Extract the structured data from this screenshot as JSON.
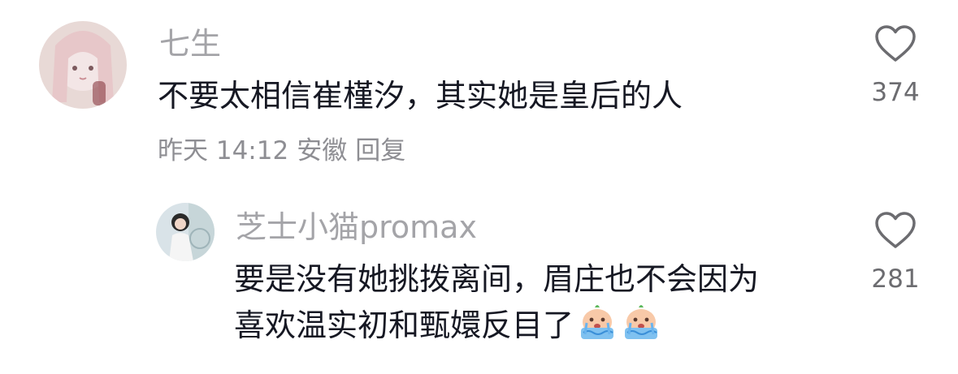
{
  "comments": [
    {
      "username": "七生",
      "text": "不要太相信崔槿汐，其实她是皇后的人",
      "time": "昨天 14:12",
      "location": "安徽",
      "reply_label": "回复",
      "likes": "374",
      "avatar_icon": "user-avatar",
      "reply": {
        "username": "芝士小猫promax",
        "text_line1": "要是没有她挑拨离间，眉庄也不会因为",
        "text_line2": "喜欢温实初和甄嬛反目了",
        "emoji_icon": "crying-emoji",
        "emoji_count": 2,
        "likes": "281",
        "avatar_icon": "user-avatar"
      }
    }
  ],
  "colors": {
    "username": "#a4a4a8",
    "content": "#161823",
    "meta": "#8e8e93",
    "icon": "#6c6c70"
  }
}
